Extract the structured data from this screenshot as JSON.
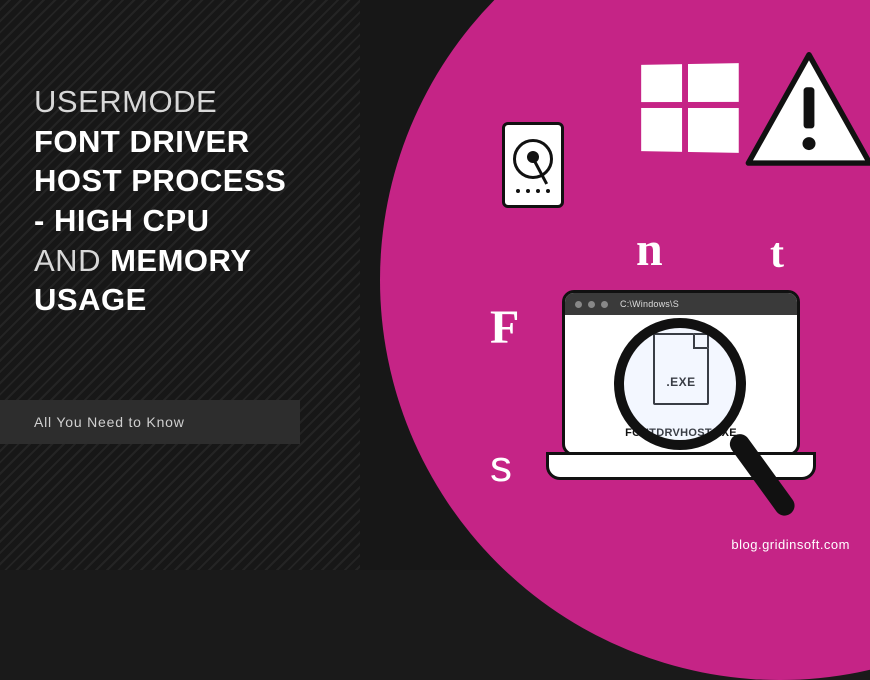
{
  "title": {
    "line1_thin": "USERMODE",
    "line2_bold": "FONT DRIVER",
    "line3_bold": "HOST PROCESS",
    "line4_prefix": "- ",
    "line4_bold": "HIGH CPU",
    "line5_thin": "AND",
    "line5_bold": " MEMORY",
    "line6_bold": "USAGE"
  },
  "subtitle": "All You Need to Know",
  "illustration": {
    "laptop_path": "C:\\Windows\\S",
    "file_ext": ".EXE",
    "file_name": "FONTDRVHOST.EXE",
    "letters": {
      "F": "F",
      "n": "n",
      "t": "t",
      "s": "s"
    }
  },
  "footer": "blog.gridinsoft.com",
  "colors": {
    "magenta": "#c52486",
    "dark": "#171717"
  }
}
